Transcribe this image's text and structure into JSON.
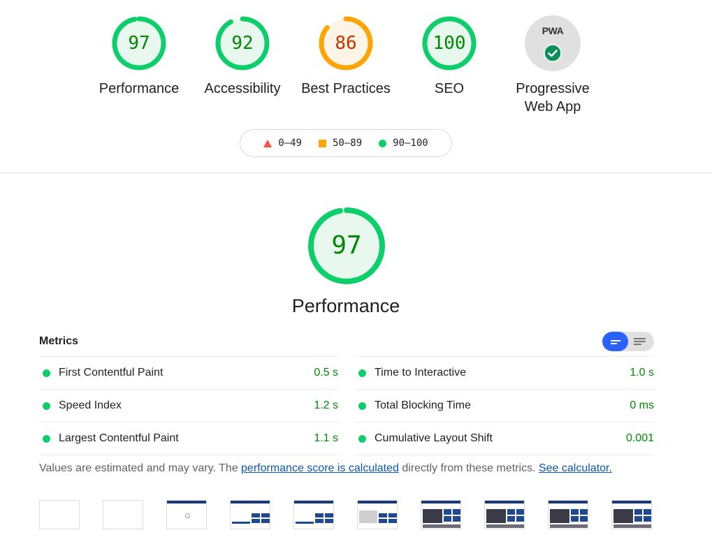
{
  "categories": [
    {
      "score": "97",
      "label": "Performance",
      "color": "#0cce6b",
      "fill": "#e8f8ef",
      "text_color": "#008800",
      "fraction": 0.97
    },
    {
      "score": "92",
      "label": "Accessibility",
      "color": "#0cce6b",
      "fill": "#e8f8ef",
      "text_color": "#008800",
      "fraction": 0.92
    },
    {
      "score": "86",
      "label": "Best Practices",
      "color": "#ffa400",
      "fill": "#fff5e6",
      "text_color": "#c33300",
      "fraction": 0.86
    },
    {
      "score": "100",
      "label": "SEO",
      "color": "#0cce6b",
      "fill": "#e8f8ef",
      "text_color": "#008800",
      "fraction": 1.0
    }
  ],
  "pwa": {
    "badge": "PWA",
    "label_line1": "Progressive",
    "label_line2": "Web App"
  },
  "legend": [
    {
      "shape": "triangle",
      "range": "0–49",
      "color": "#ff4e42"
    },
    {
      "shape": "square",
      "range": "50–89",
      "color": "#ffa400"
    },
    {
      "shape": "circle",
      "range": "90–100",
      "color": "#0cce6b"
    }
  ],
  "performance": {
    "score": "97",
    "label": "Performance",
    "fraction": 0.97
  },
  "metrics": {
    "title": "Metrics",
    "left": [
      {
        "name": "First Contentful Paint",
        "value": "0.5 s"
      },
      {
        "name": "Speed Index",
        "value": "1.2 s"
      },
      {
        "name": "Largest Contentful Paint",
        "value": "1.1 s"
      }
    ],
    "right": [
      {
        "name": "Time to Interactive",
        "value": "1.0 s"
      },
      {
        "name": "Total Blocking Time",
        "value": "0 ms"
      },
      {
        "name": "Cumulative Layout Shift",
        "value": "0.001"
      }
    ]
  },
  "note": {
    "prefix": "Values are estimated and may vary. The ",
    "link1": "performance score is calculated",
    "middle": " directly from these metrics. ",
    "link2": "See calculator."
  },
  "colors": {
    "pass": "#0cce6b",
    "average": "#ffa400",
    "fail": "#ff4e42",
    "link": "#0b57b0",
    "toggle_active": "#2962ff"
  }
}
